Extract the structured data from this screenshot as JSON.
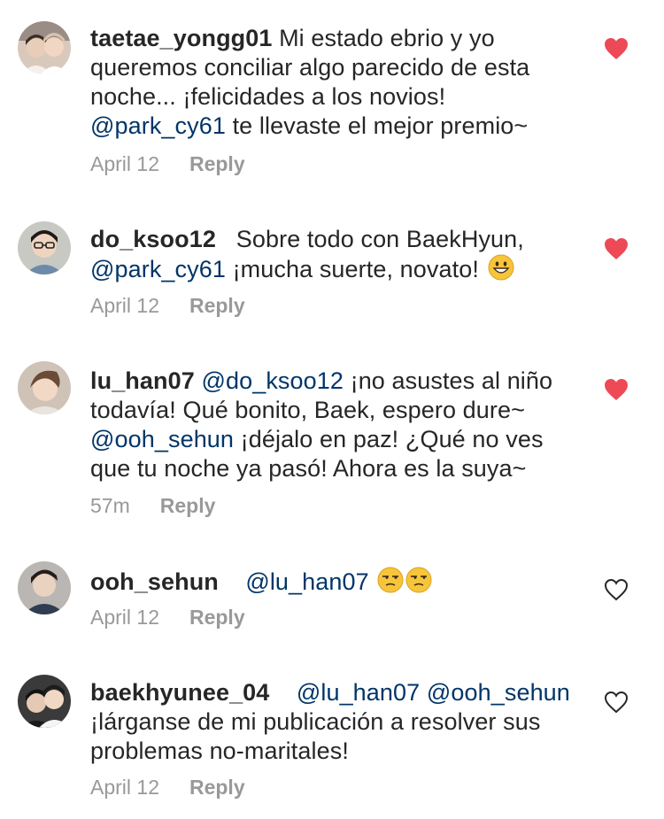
{
  "colors": {
    "mention": "#003569",
    "meta_text": "#999999",
    "liked_heart": "#ed4956",
    "unliked_heart": "#262626"
  },
  "comments": [
    {
      "username": "taetae_yongg01",
      "parts": [
        {
          "text": "Mi estado ebrio y yo queremos conciliar algo parecido de esta noche... ¡felicidades a los novios! "
        },
        {
          "text": "@park_cy61",
          "mention": true
        },
        {
          "text": " te llevaste el mejor premio~"
        }
      ],
      "time": "April 12",
      "reply_label": "Reply",
      "liked": true,
      "heart_icon": "heart-filled-icon"
    },
    {
      "username": "do_ksoo12",
      "parts": [
        {
          "text": "  Sobre todo con BaekHyun, "
        },
        {
          "text": "@park_cy61",
          "mention": true
        },
        {
          "text": " ¡mucha suerte, novato! "
        },
        {
          "emoji": "grinning-face-emoji"
        }
      ],
      "time": "April 12",
      "reply_label": "Reply",
      "liked": true,
      "heart_icon": "heart-filled-icon"
    },
    {
      "username": "lu_han07",
      "parts": [
        {
          "text": " "
        },
        {
          "text": "@do_ksoo12",
          "mention": true
        },
        {
          "text": " ¡no asustes al niño todavía! Qué bonito, Baek, espero dure~ "
        },
        {
          "text": "@ooh_sehun",
          "mention": true
        },
        {
          "text": " ¡déjalo en paz! ¿Qué no ves que tu noche ya pasó! Ahora es la suya~"
        }
      ],
      "time": "57m",
      "reply_label": "Reply",
      "liked": true,
      "heart_icon": "heart-filled-icon"
    },
    {
      "username": "ooh_sehun",
      "parts": [
        {
          "text": "   "
        },
        {
          "text": "@lu_han07",
          "mention": true
        },
        {
          "text": " "
        },
        {
          "emoji": "unamused-face-emoji"
        },
        {
          "emoji": "unamused-face-emoji"
        }
      ],
      "time": "April 12",
      "reply_label": "Reply",
      "liked": false,
      "heart_icon": "heart-outline-icon"
    },
    {
      "username": "baekhyunee_04",
      "parts": [
        {
          "text": "   "
        },
        {
          "text": "@lu_han07",
          "mention": true
        },
        {
          "text": " "
        },
        {
          "text": "@ooh_sehun",
          "mention": true
        },
        {
          "text": " ¡lárganse de mi publicación a resolver sus problemas no-maritales!"
        }
      ],
      "time": "April 12",
      "reply_label": "Reply",
      "liked": false,
      "heart_icon": "heart-outline-icon"
    }
  ]
}
